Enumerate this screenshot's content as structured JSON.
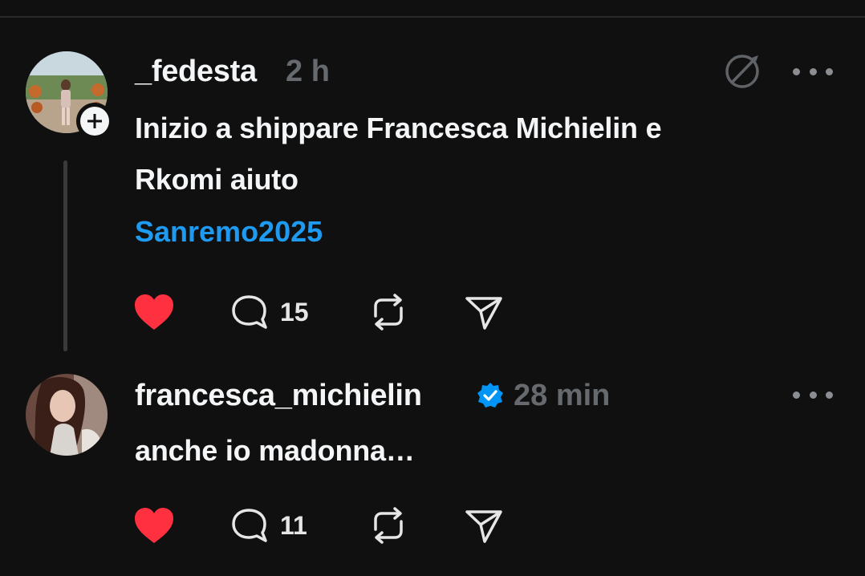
{
  "posts": [
    {
      "username": "_fedesta",
      "time": "2 h",
      "text_line1": "Inizio a shippare Francesca Michielin e",
      "text_line2": "Rkomi aiuto",
      "hashtag": "Sanremo2025",
      "replies": "15",
      "liked": true
    },
    {
      "username": "francesca_michielin",
      "verified": true,
      "time": "28 min",
      "text": "anche io madonna…",
      "replies": "11",
      "liked": true
    }
  ],
  "colors": {
    "background": "#101010",
    "like": "#ff3040",
    "hashtag": "#1e9bf0",
    "verified": "#0095f6"
  },
  "icons": [
    "plus-icon",
    "heart-icon",
    "comment-icon",
    "repost-icon",
    "share-icon",
    "mute-icon",
    "more-icon",
    "verified-icon"
  ]
}
